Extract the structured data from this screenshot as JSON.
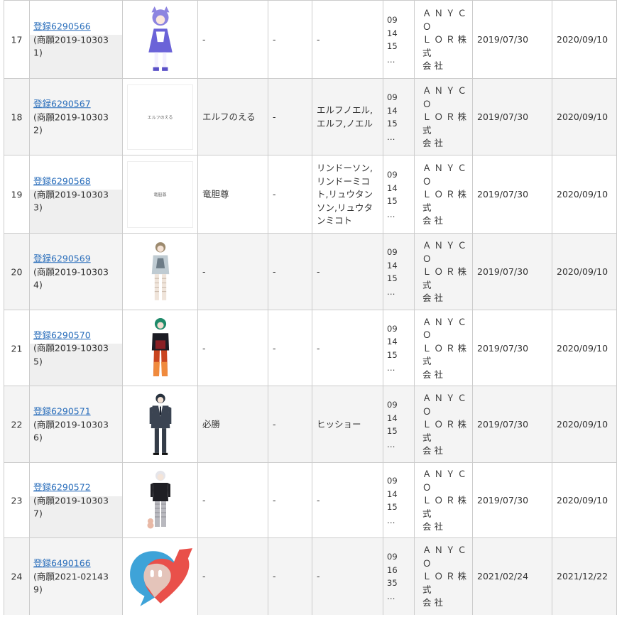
{
  "rows": [
    {
      "num": "17",
      "reg_link": "登録6290566",
      "app_no": "(商願2019-10303",
      "app_suffix": "1)",
      "image": "blue-dress-character",
      "name": "-",
      "col_a": "-",
      "reading": "-",
      "cls": [
        "09",
        "14",
        "15",
        "…"
      ],
      "owner": [
        "ＡＮＹＣＯ",
        "ＬＯＲ株式",
        "会社"
      ],
      "date1": "2019/07/30",
      "date2": "2020/09/10"
    },
    {
      "num": "18",
      "reg_link": "登録6290567",
      "app_no": "(商願2019-10303",
      "app_suffix": "2)",
      "image": "text-card",
      "image_text": "エルフのえる",
      "name": "エルフのえる",
      "col_a": "-",
      "reading": "エルフノエル,エルフ,ノエル",
      "cls": [
        "09",
        "14",
        "15",
        "…"
      ],
      "owner": [
        "ＡＮＹＣＯ",
        "ＬＯＲ株式",
        "会社"
      ],
      "date1": "2019/07/30",
      "date2": "2020/09/10"
    },
    {
      "num": "19",
      "reg_link": "登録6290568",
      "app_no": "(商願2019-10303",
      "app_suffix": "3)",
      "image": "text-card",
      "image_text": "竜胆尊",
      "name": "竜胆尊",
      "col_a": "-",
      "reading": "リンドーソン,リンドーミコト,リュウタンソン,リュウタンミコト",
      "cls": [
        "09",
        "14",
        "15",
        "…"
      ],
      "owner": [
        "ＡＮＹＣＯ",
        "ＬＯＲ株式",
        "会社"
      ],
      "date1": "2019/07/30",
      "date2": "2020/09/10"
    },
    {
      "num": "20",
      "reg_link": "登録6290569",
      "app_no": "(商願2019-10303",
      "app_suffix": "4)",
      "image": "hoodie-character",
      "name": "-",
      "col_a": "-",
      "reading": "-",
      "cls": [
        "09",
        "14",
        "15",
        "…"
      ],
      "owner": [
        "ＡＮＹＣＯ",
        "ＬＯＲ株式",
        "会社"
      ],
      "date1": "2019/07/30",
      "date2": "2020/09/10"
    },
    {
      "num": "21",
      "reg_link": "登録6290570",
      "app_no": "(商願2019-10303",
      "app_suffix": "5)",
      "image": "green-hair-character",
      "name": "-",
      "col_a": "-",
      "reading": "-",
      "cls": [
        "09",
        "14",
        "15",
        "…"
      ],
      "owner": [
        "ＡＮＹＣＯ",
        "ＬＯＲ株式",
        "会社"
      ],
      "date1": "2019/07/30",
      "date2": "2020/09/10"
    },
    {
      "num": "22",
      "reg_link": "登録6290571",
      "app_no": "(商願2019-10303",
      "app_suffix": "6)",
      "image": "suit-character",
      "name": "必勝",
      "col_a": "-",
      "reading": "ヒッショー",
      "cls": [
        "09",
        "14",
        "15",
        "…"
      ],
      "owner": [
        "ＡＮＹＣＯ",
        "ＬＯＲ株式",
        "会社"
      ],
      "date1": "2019/07/30",
      "date2": "2020/09/10"
    },
    {
      "num": "23",
      "reg_link": "登録6290572",
      "app_no": "(商願2019-10303",
      "app_suffix": "7)",
      "image": "white-hair-character",
      "name": "-",
      "col_a": "-",
      "reading": "-",
      "cls": [
        "09",
        "14",
        "15",
        "…"
      ],
      "owner": [
        "ＡＮＹＣＯ",
        "ＬＯＲ株式",
        "会社"
      ],
      "date1": "2019/07/30",
      "date2": "2020/09/10"
    },
    {
      "num": "24",
      "reg_link": "登録6490166",
      "app_no": "(商願2021-02143",
      "app_suffix": "9)",
      "image": "speech-bubble-logo",
      "name": "-",
      "col_a": "-",
      "reading": "-",
      "cls": [
        "09",
        "16",
        "35",
        "…"
      ],
      "owner": [
        "ＡＮＹＣＯ",
        "ＬＯＲ株式",
        "会社"
      ],
      "date1": "2021/02/24",
      "date2": "2021/12/22"
    }
  ],
  "colors": {
    "link": "#2a6ebb",
    "border": "#cccccc",
    "alt_row": "#f4f4f4",
    "logo_blue": "#3ea3d8",
    "logo_red": "#e9504a"
  }
}
